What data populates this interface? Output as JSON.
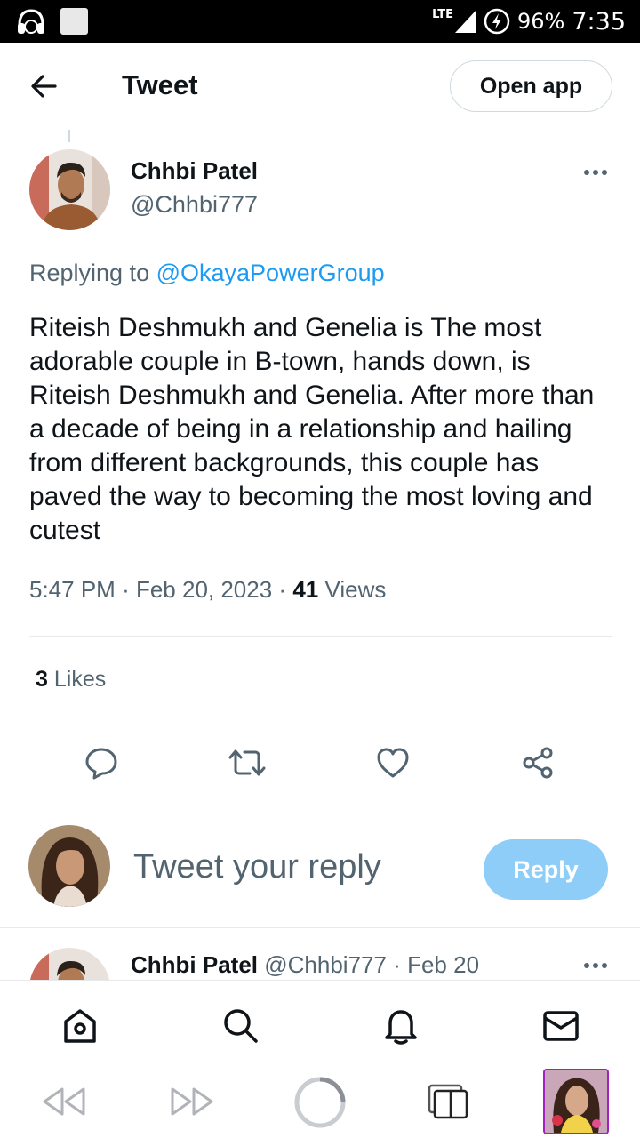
{
  "status_bar": {
    "network": "LTE",
    "battery": "96%",
    "time": "7:35"
  },
  "header": {
    "title": "Tweet",
    "open_app": "Open app"
  },
  "tweet": {
    "author_name": "Chhbi Patel",
    "author_handle": "@Chhbi777",
    "replying_prefix": "Replying to",
    "replying_to": "@OkayaPowerGroup",
    "text": "Riteish Deshmukh and Genelia is The most adorable couple in B-town, hands down, is Riteish Deshmukh and Genelia. After more than a decade of being in a relationship and hailing from different backgrounds, this couple has paved the way to becoming the most loving and cutest",
    "time": "5:47 PM",
    "date": "Feb 20, 2023",
    "views_count": "41",
    "views_label": "Views",
    "likes_count": "3",
    "likes_label": "Likes"
  },
  "composer": {
    "placeholder": "Tweet your reply",
    "reply_button": "Reply"
  },
  "next_tweet": {
    "author_name": "Chhbi Patel",
    "author_handle": "@Chhbi777",
    "date": "Feb 20"
  },
  "icons": {
    "reply": "comment-icon",
    "retweet": "retweet-icon",
    "like": "heart-icon",
    "share": "share-icon",
    "home": "home-icon",
    "search": "search-icon",
    "notifications": "bell-icon",
    "messages": "mail-icon"
  },
  "colors": {
    "accent": "#1d9bf0",
    "reply_button_bg": "#8ecdf8",
    "secondary_text": "#536471"
  }
}
